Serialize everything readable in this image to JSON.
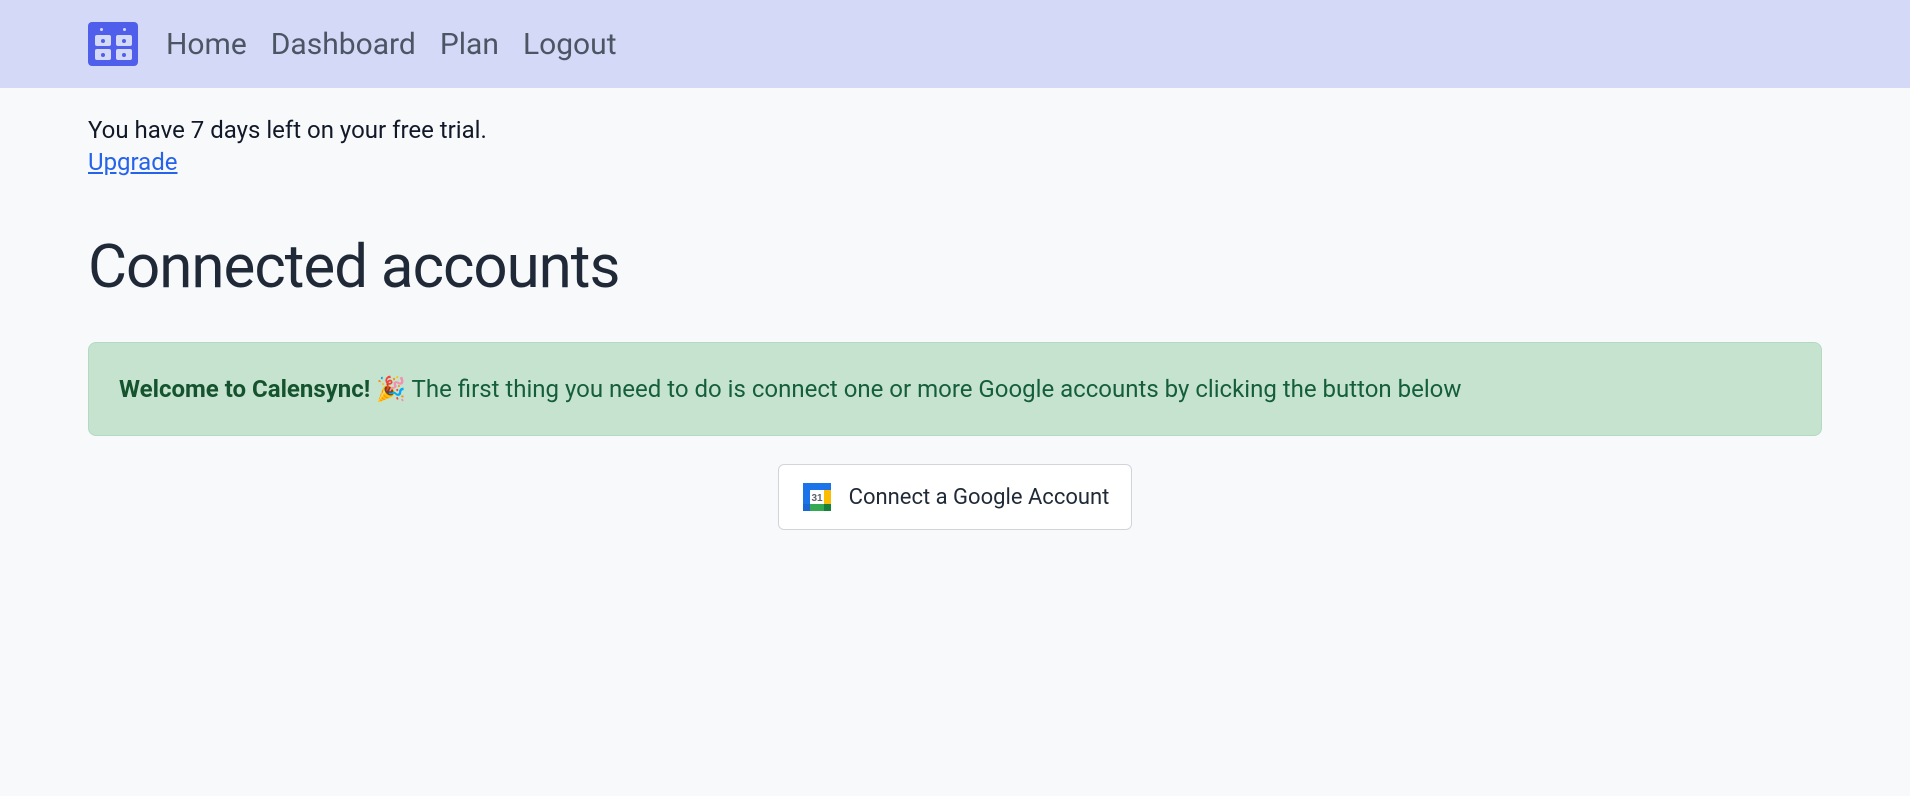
{
  "nav": {
    "links": [
      "Home",
      "Dashboard",
      "Plan",
      "Logout"
    ]
  },
  "trial": {
    "message": "You have 7 days left on your free trial.",
    "upgrade_label": "Upgrade"
  },
  "page": {
    "title": "Connected accounts"
  },
  "welcome": {
    "strong": "Welcome to Calensync!",
    "emoji": "🎉",
    "text": " The first thing you need to do is connect one or more Google accounts by clicking the button below"
  },
  "connect": {
    "button_label": "Connect a Google Account"
  }
}
